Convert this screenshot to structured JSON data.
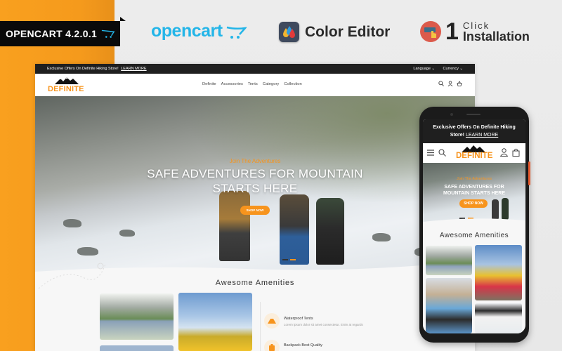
{
  "banner": {
    "version_badge": "OPENCART 4.2.0.1",
    "opencart_logo": "opencart",
    "color_editor": "Color Editor",
    "one_click_number": "1",
    "one_click_small": "Click",
    "one_click_big": "Installation",
    "accent_color": "#f7941d",
    "opencart_color": "#23b5e8"
  },
  "desktop": {
    "topbar": {
      "offer_text": "Exclusive Offers On Definite Hiking Store!",
      "learn_more": "LEARN MORE",
      "language": "Language ⌄",
      "currency": "Currency ⌄"
    },
    "brand": "DEFINITE",
    "nav": [
      "Definite",
      "Accessories",
      "Tents",
      "Category",
      "Collection"
    ],
    "header_icons": [
      "search-icon",
      "user-icon",
      "basket-icon"
    ],
    "hero": {
      "subtitle": "Join The Adventures",
      "title_line1": "SAFE ADVENTURES FOR MOUNTAIN",
      "title_line2": "STARTS HERE",
      "button": "SHOP NOW",
      "slides": 2,
      "active_slide": 2
    },
    "amenities": {
      "title": "Awesome Amenities",
      "features": [
        {
          "icon": "tent-icon",
          "title": "Waterproof Tents",
          "desc": "Lorem ipsum dolor sit amet consectetur. Enim at regards"
        },
        {
          "icon": "backpack-icon",
          "title": "Backpack Best Quality",
          "desc": ""
        }
      ]
    }
  },
  "mobile": {
    "offer_line1": "Exclusive Offers On Definite Hiking",
    "offer_line2": "Store!",
    "learn_more": "LEARN MORE",
    "brand": "DEFINITE",
    "hero": {
      "subtitle": "Join The Adventures",
      "title_line1": "SAFE ADVENTURES FOR",
      "title_line2": "MOUNTAIN STARTS HERE",
      "button": "SHOP NOW"
    },
    "amenities_title": "Awesome Amenities"
  }
}
